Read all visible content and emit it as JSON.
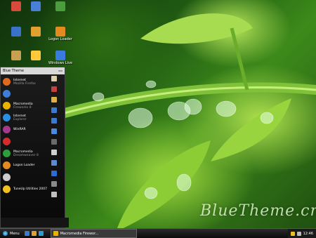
{
  "desktop_icons": [
    {
      "label": "",
      "color": "#d64b3c"
    },
    {
      "label": "",
      "color": "#4a7fd8"
    },
    {
      "label": "",
      "color": "#4b9d3d"
    },
    {
      "label": "",
      "color": "#3a72c9"
    },
    {
      "label": "",
      "color": "#e0a030"
    },
    {
      "label": "Logon Loader",
      "color": "#e58a1f"
    },
    {
      "label": "",
      "color": "#c8a050"
    },
    {
      "label": "",
      "color": "#ffc93c"
    },
    {
      "label": "Windows Live",
      "color": "#3a7be0"
    }
  ],
  "start_menu": {
    "user": "Blue Theme",
    "header_button": "",
    "items": [
      {
        "label": "Internet",
        "sub": "Mozilla Firefox",
        "color": "#e06a1c"
      },
      {
        "label": "",
        "sub": "",
        "color": "#3e7ed8"
      },
      {
        "label": "Macromedia",
        "sub": "Fireworks 8",
        "color": "#e9b200"
      },
      {
        "label": "Internet",
        "sub": "Explorer",
        "color": "#2b8fe0"
      },
      {
        "label": "WinRAR",
        "sub": "",
        "color": "#a33b8c"
      },
      {
        "label": "",
        "sub": "",
        "color": "#d12d2d"
      },
      {
        "label": "Macromedia",
        "sub": "Dreamweaver 8",
        "color": "#2c9c3c"
      },
      {
        "label": "Logon Loader",
        "sub": "",
        "color": "#e58a1f"
      },
      {
        "label": "",
        "sub": "",
        "color": "#cccccc"
      },
      {
        "label": "TuneUp Utilities 2007",
        "sub": "",
        "color": "#f0c020"
      }
    ],
    "right_colors": [
      "#e0d0b0",
      "#c64040",
      "#e0b040",
      "#3a7ad0",
      "#3a7ad0",
      "#4a8ae0",
      "#6a6a6a",
      "#d0d0d0",
      "#5a8ad0",
      "#2c6cd0",
      "#8a8a8a",
      "#c0c0c0"
    ],
    "all_programs": "",
    "footer": [
      "",
      ""
    ]
  },
  "taskbar": {
    "start_label": "Menu",
    "task_label": "Macromedia Firewor...",
    "clock": "12:46",
    "quick_colors": [
      "#3a7ad0",
      "#e0a030",
      "#2c9cd0"
    ]
  },
  "watermark": "BlueTheme.cn"
}
